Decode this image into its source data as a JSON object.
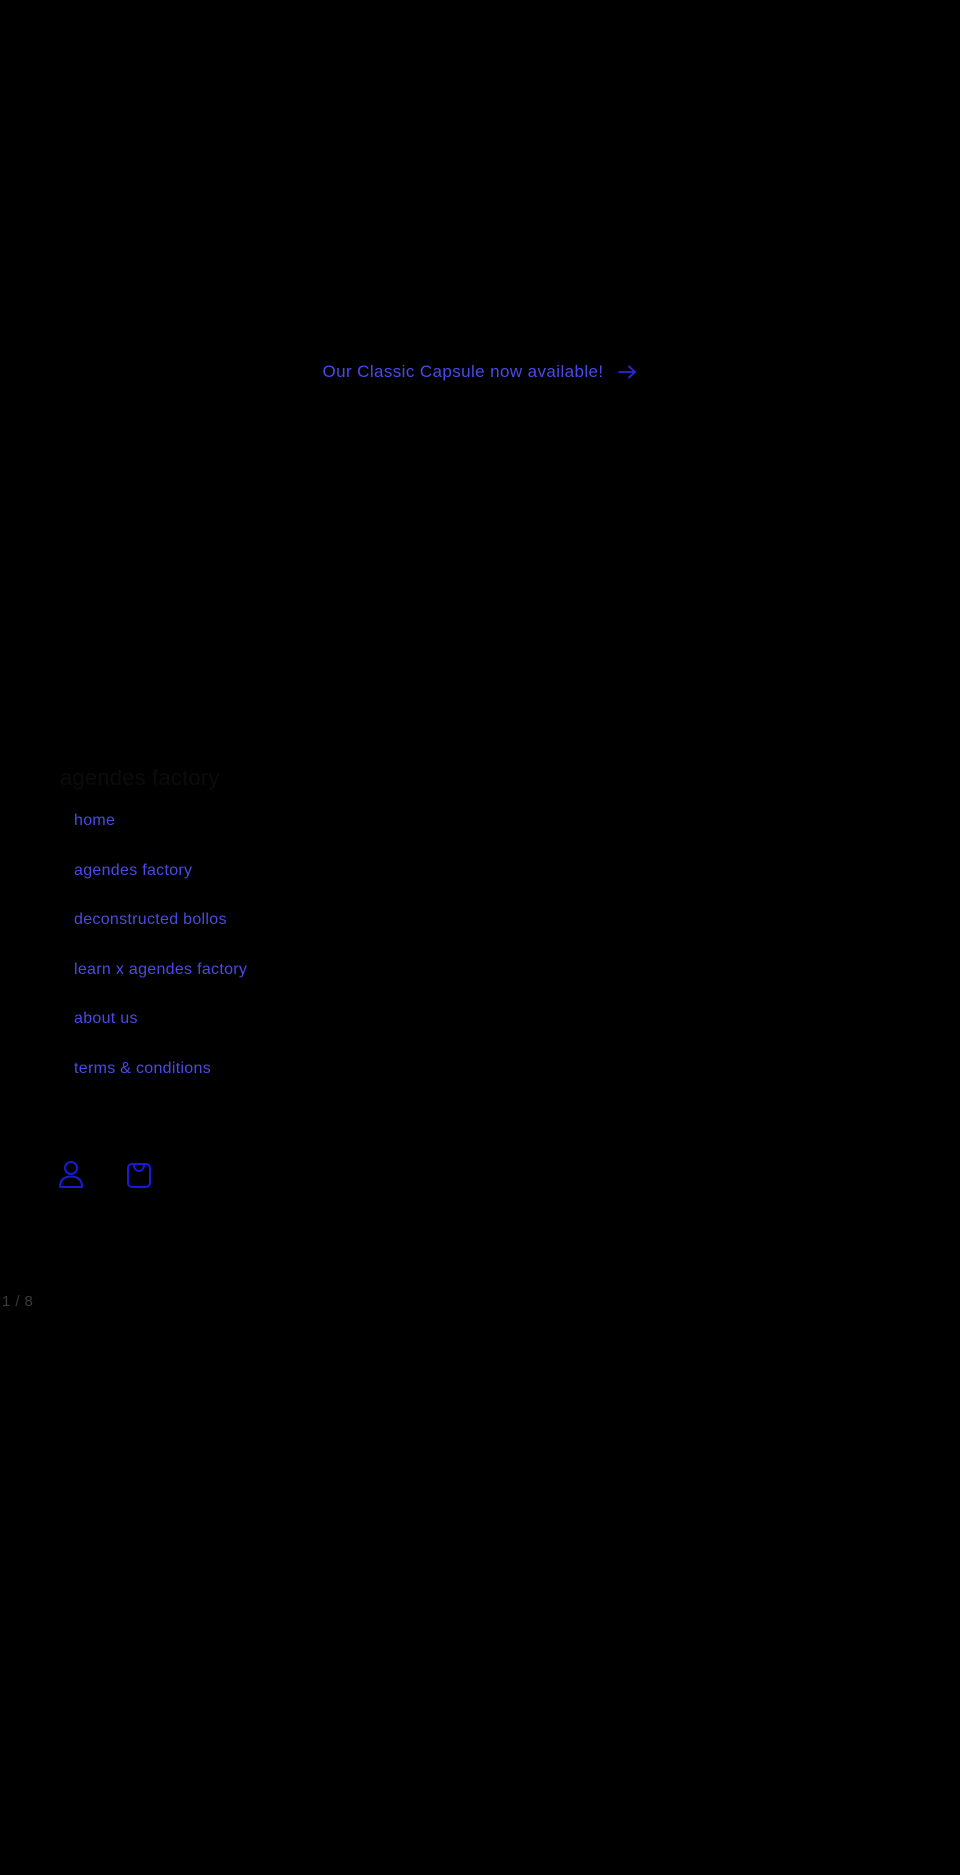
{
  "announcement": {
    "text": "Our Classic Capsule now available!",
    "arrow_icon": "arrow-right-icon"
  },
  "drawer": {
    "brand": "agendes factory",
    "menu": [
      {
        "label": "home"
      },
      {
        "label": "agendes factory"
      },
      {
        "label": "deconstructed bollos"
      },
      {
        "label": "learn x agendes factory"
      },
      {
        "label": "about us"
      },
      {
        "label": "terms & conditions"
      }
    ],
    "utility_icons": [
      "account-icon",
      "cart-icon"
    ]
  },
  "pager": {
    "current": "1",
    "separator": "/",
    "total": "8"
  },
  "colors": {
    "background": "#000000",
    "link": "#4a4ae6",
    "icon": "#1a1ad6"
  }
}
